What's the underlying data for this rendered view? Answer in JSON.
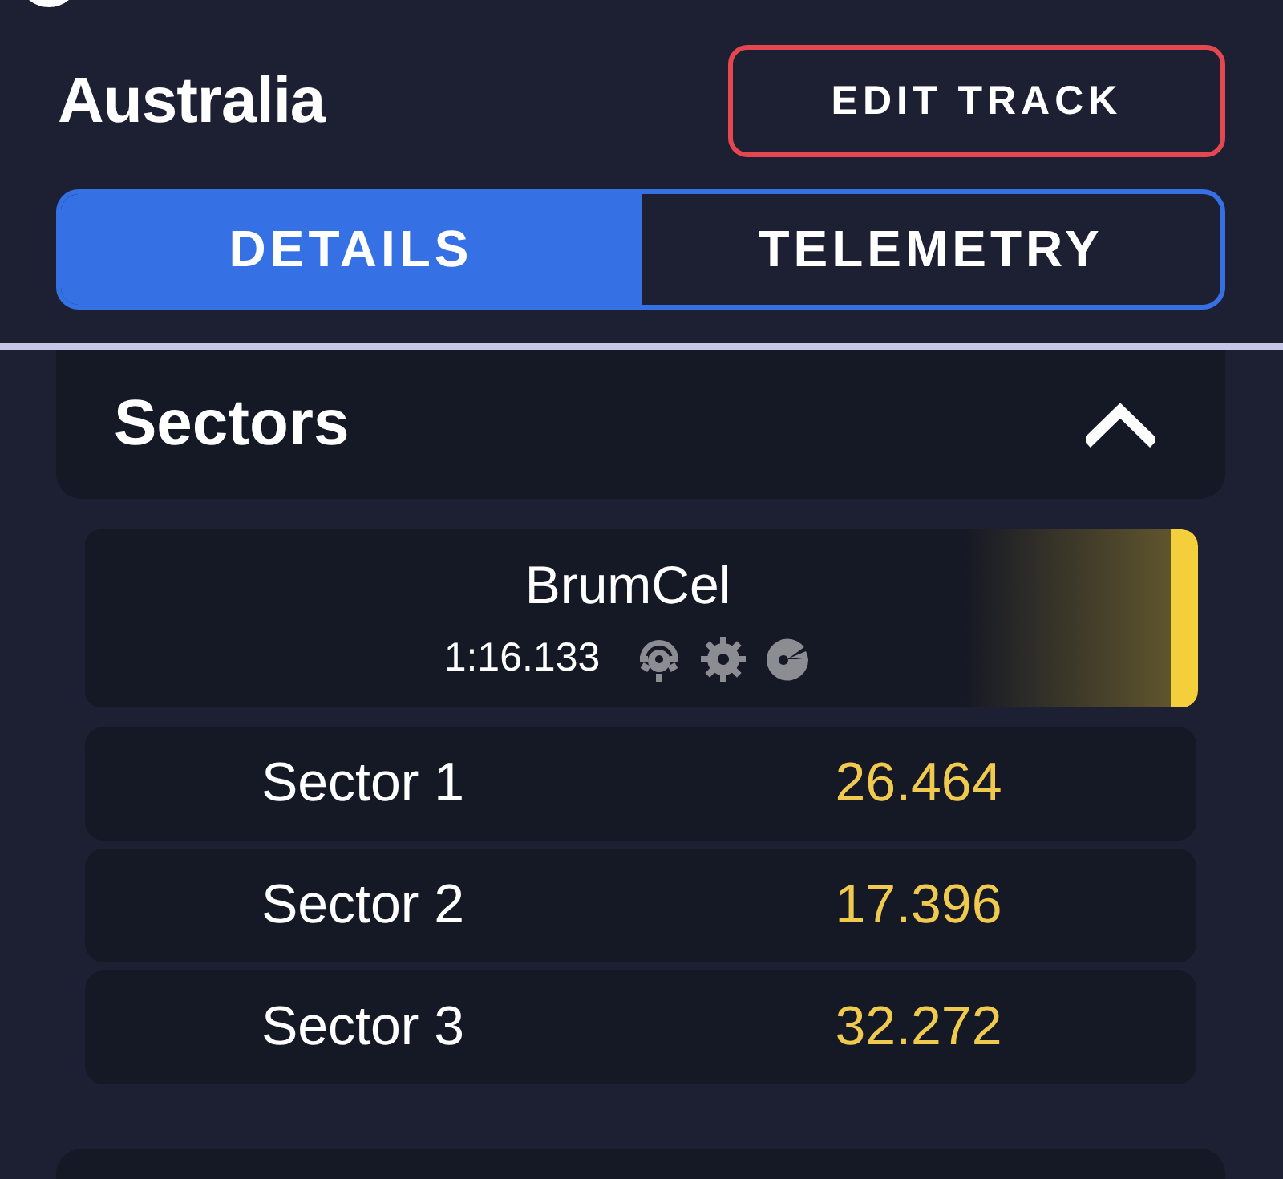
{
  "header": {
    "title": "Australia",
    "edit_button": "EDIT TRACK"
  },
  "tabs": [
    {
      "label": "DETAILS",
      "selected": true
    },
    {
      "label": "TELEMETRY",
      "selected": false
    }
  ],
  "sectors": {
    "title": "Sectors",
    "expanded": true,
    "laps": [
      {
        "driver": "BrumCel",
        "time": "1:16.133",
        "color": "#f4cf3c"
      }
    ],
    "rows": [
      {
        "name": "Sector 1",
        "time": "26.464"
      },
      {
        "name": "Sector 2",
        "time": "17.396"
      },
      {
        "name": "Sector 3",
        "time": "32.272"
      }
    ]
  }
}
